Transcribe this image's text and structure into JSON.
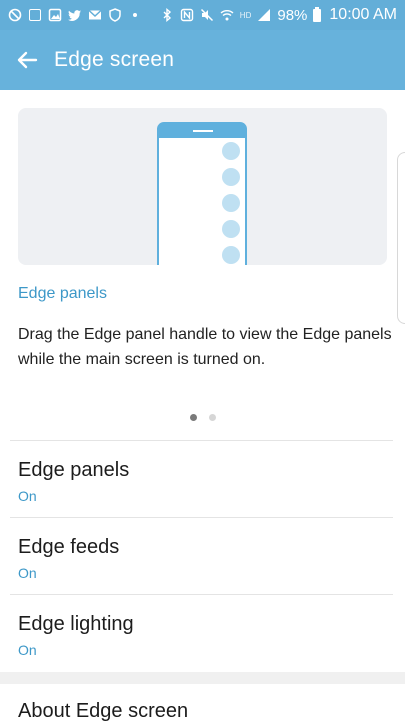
{
  "status_bar": {
    "battery": "98%",
    "time": "10:00 AM",
    "network_label": "HD",
    "left_icons": [
      "block-icon",
      "samsung-icon",
      "gallery-icon",
      "twitter-icon",
      "gmail-icon",
      "shield-icon",
      "more-icon"
    ],
    "right_icons": [
      "bluetooth-icon",
      "nfc-icon",
      "mute-icon",
      "wifi-icon",
      "signal-icon",
      "battery-icon"
    ]
  },
  "app_bar": {
    "title": "Edge screen"
  },
  "preview": {
    "panel_label": "Edge panels",
    "description": "Drag the Edge panel handle to view the Edge panels while the main screen is turned on.",
    "page_count": 2,
    "active_page": 1
  },
  "settings": [
    {
      "title": "Edge panels",
      "status": "On"
    },
    {
      "title": "Edge feeds",
      "status": "On"
    },
    {
      "title": "Edge lighting",
      "status": "On"
    }
  ],
  "about": {
    "title": "About Edge screen"
  },
  "colors": {
    "status_bar": "#63aed8",
    "app_bar": "#67b2dc",
    "accent": "#3d98c8"
  }
}
